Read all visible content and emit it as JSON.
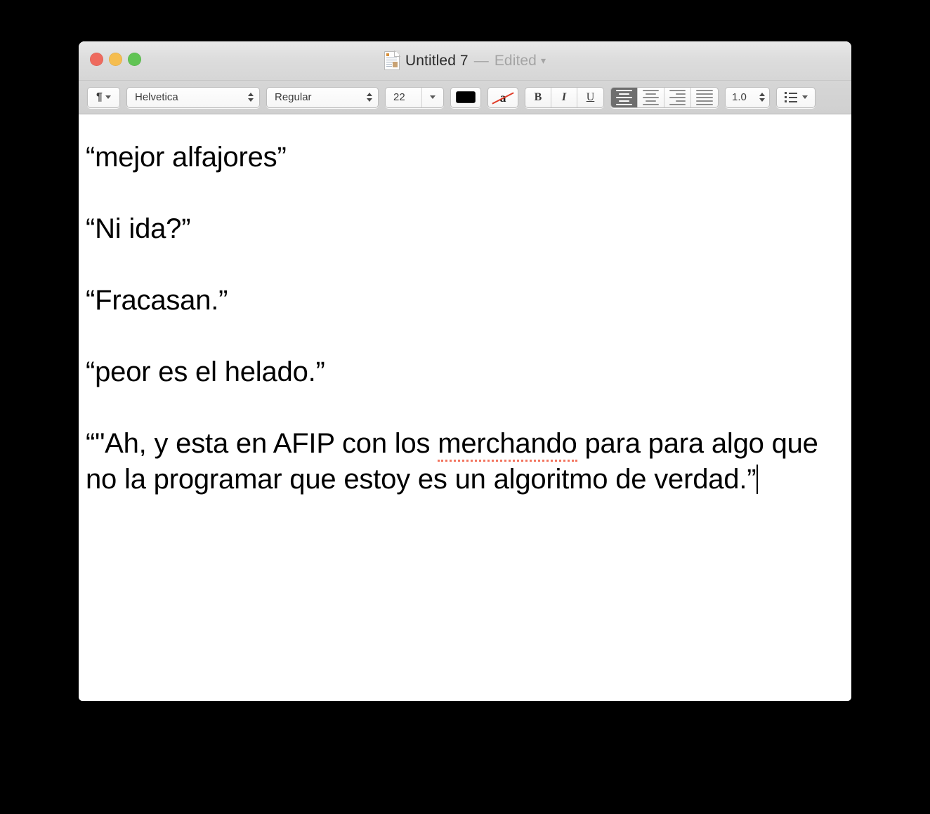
{
  "window": {
    "title": "Untitled 7",
    "title_separator": "—",
    "edited_label": "Edited",
    "doc_icon": "document-page-icon",
    "traffic_lights": {
      "close_color": "#ee6a5e",
      "minimize_color": "#f5bd4f",
      "maximize_color": "#61c454"
    }
  },
  "toolbar": {
    "paragraph_style_icon": "pilcrow-icon",
    "font_family": "Helvetica",
    "font_style": "Regular",
    "font_size": "22",
    "text_color": "#000000",
    "background_color_icon": "a-strikethrough-icon",
    "bold_label": "B",
    "italic_label": "I",
    "underline_label": "U",
    "align_left": "align-left-icon",
    "align_center": "align-center-icon",
    "align_right": "align-right-icon",
    "align_justify": "align-justify-icon",
    "align_selected": "align-left",
    "line_spacing": "1.0",
    "list_icon": "bulleted-list-icon"
  },
  "document": {
    "paragraphs": [
      {
        "text": "“mejor alfajores”"
      },
      {
        "text": "“Ni ida?”"
      },
      {
        "text": "“Fracasan.”"
      },
      {
        "text": "“peor es el helado.”"
      }
    ],
    "last_paragraph": {
      "before_misspelling": "“\"Ah, y esta en AFIP con los ",
      "misspelled_word": "merchando",
      "after_misspelling": " para para algo que no la programar que estoy es un algoritmo de verdad.”"
    },
    "misspelling_underline_color": "#f2745f",
    "caret_visible": true
  }
}
